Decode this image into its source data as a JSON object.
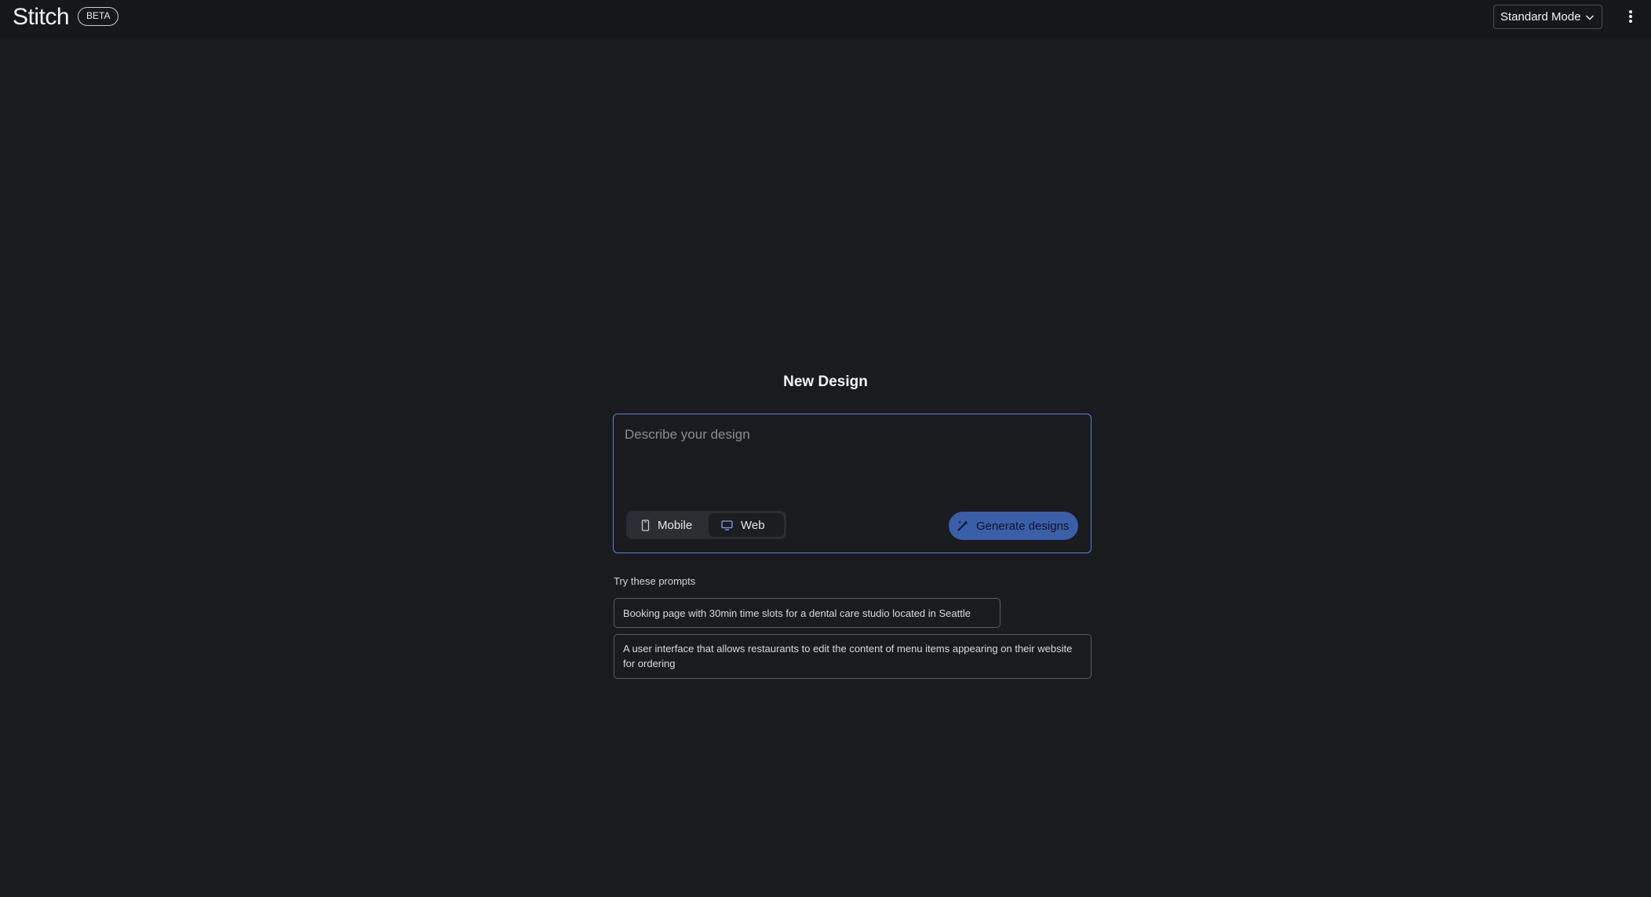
{
  "header": {
    "logo_text": "Stitch",
    "beta_badge": "BETA",
    "mode_select": {
      "selected": "Standard Mode"
    },
    "more_menu_icon": "vertical-dots-icon"
  },
  "main": {
    "title": "New Design",
    "prompt_input": {
      "placeholder": "Describe your design",
      "value": ""
    },
    "device_toggle": {
      "options": [
        {
          "label": "Mobile",
          "icon": "phone-icon",
          "selected": false
        },
        {
          "label": "Web",
          "icon": "monitor-icon",
          "selected": true
        }
      ]
    },
    "generate_button": {
      "label": "Generate designs",
      "icon": "magic-wand-icon"
    },
    "suggestions": {
      "label": "Try these prompts",
      "items": [
        "Booking page with 30min time slots for a dental care studio located in Seattle",
        "A user interface that allows restaurants to edit the content of menu items appearing on their website for ordering"
      ]
    }
  },
  "colors": {
    "background": "#1a1b1f",
    "topbar": "#16171a",
    "accent": "#3b5ea8",
    "focus_border": "#5b7fd6"
  }
}
